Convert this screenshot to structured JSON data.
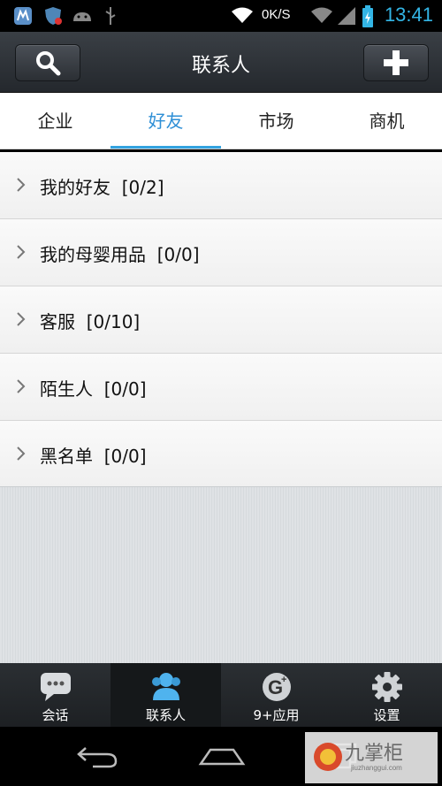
{
  "status_bar": {
    "speed": "0K/S",
    "time": "13:41"
  },
  "header": {
    "title": "联系人",
    "search_icon": "search-icon",
    "add_icon": "plus-icon"
  },
  "tabs": [
    {
      "label": "企业",
      "active": false
    },
    {
      "label": "好友",
      "active": true
    },
    {
      "label": "市场",
      "active": false
    },
    {
      "label": "商机",
      "active": false
    }
  ],
  "groups": [
    {
      "label": "我的好友  [0/2]"
    },
    {
      "label": "我的母婴用品  [0/0]"
    },
    {
      "label": "客服  [0/10]"
    },
    {
      "label": "陌生人  [0/0]"
    },
    {
      "label": "黑名单  [0/0]"
    }
  ],
  "bottom_nav": [
    {
      "label": "会话",
      "icon": "chat-bubble-icon",
      "active": false
    },
    {
      "label": "联系人",
      "icon": "contacts-icon",
      "active": true
    },
    {
      "label": "9+应用",
      "icon": "apps-icon",
      "active": false
    },
    {
      "label": "设置",
      "icon": "gear-icon",
      "active": false
    }
  ],
  "watermark": {
    "text": "九掌柜",
    "sub": "jiuzhanggui.com"
  },
  "colors": {
    "accent": "#33a3e0",
    "time": "#33b5e5"
  }
}
